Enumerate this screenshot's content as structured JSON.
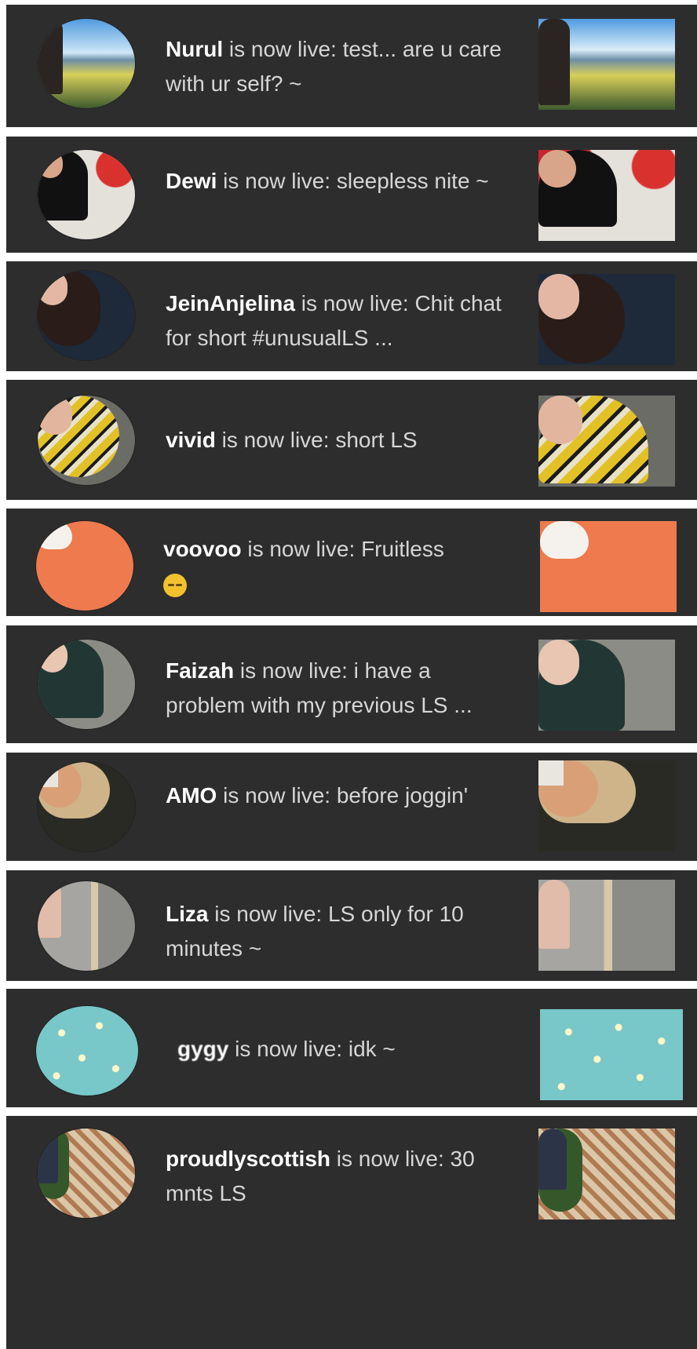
{
  "live_text": "is now live:",
  "notifications": [
    {
      "name": "Nurul",
      "title": "test... are u care with ur self? ~",
      "avatar_icon": "woman-in-landscape-photo"
    },
    {
      "name": "Dewi",
      "title": "sleepless nite ~",
      "avatar_icon": "hijab-woman-red-background-photo"
    },
    {
      "name": "JeinAnjelina",
      "title": "Chit chat for short #unusualLS ...",
      "avatar_icon": "woman-curly-hair-photo"
    },
    {
      "name": "vivid",
      "title": "short LS",
      "avatar_icon": "hijab-woman-yellow-scarf-photo"
    },
    {
      "name": "voovoo",
      "title": "Fruitless",
      "avatar_icon": "white-bunny-orange-background-photo"
    },
    {
      "name": "Faizah",
      "title": "i have a problem with my previous LS ...",
      "avatar_icon": "hijab-woman-in-car-photo"
    },
    {
      "name": "AMO",
      "title": "before joggin'",
      "avatar_icon": "baroque-portrait-meme-photo"
    },
    {
      "name": "Liza",
      "title": "LS only for 10 minutes ~",
      "avatar_icon": "woman-at-door-photo"
    },
    {
      "name": "gygy",
      "title": "idk ~",
      "avatar_icon": "flower-pattern-teal-photo"
    },
    {
      "name": "proudlyscottish",
      "title": "30 mnts LS",
      "avatar_icon": "woman-in-garden-photo"
    }
  ],
  "colors": {
    "card_bg": "#2d2d2e",
    "text": "#d6d6d6",
    "name": "#ffffff",
    "separator": "#ffffff"
  }
}
